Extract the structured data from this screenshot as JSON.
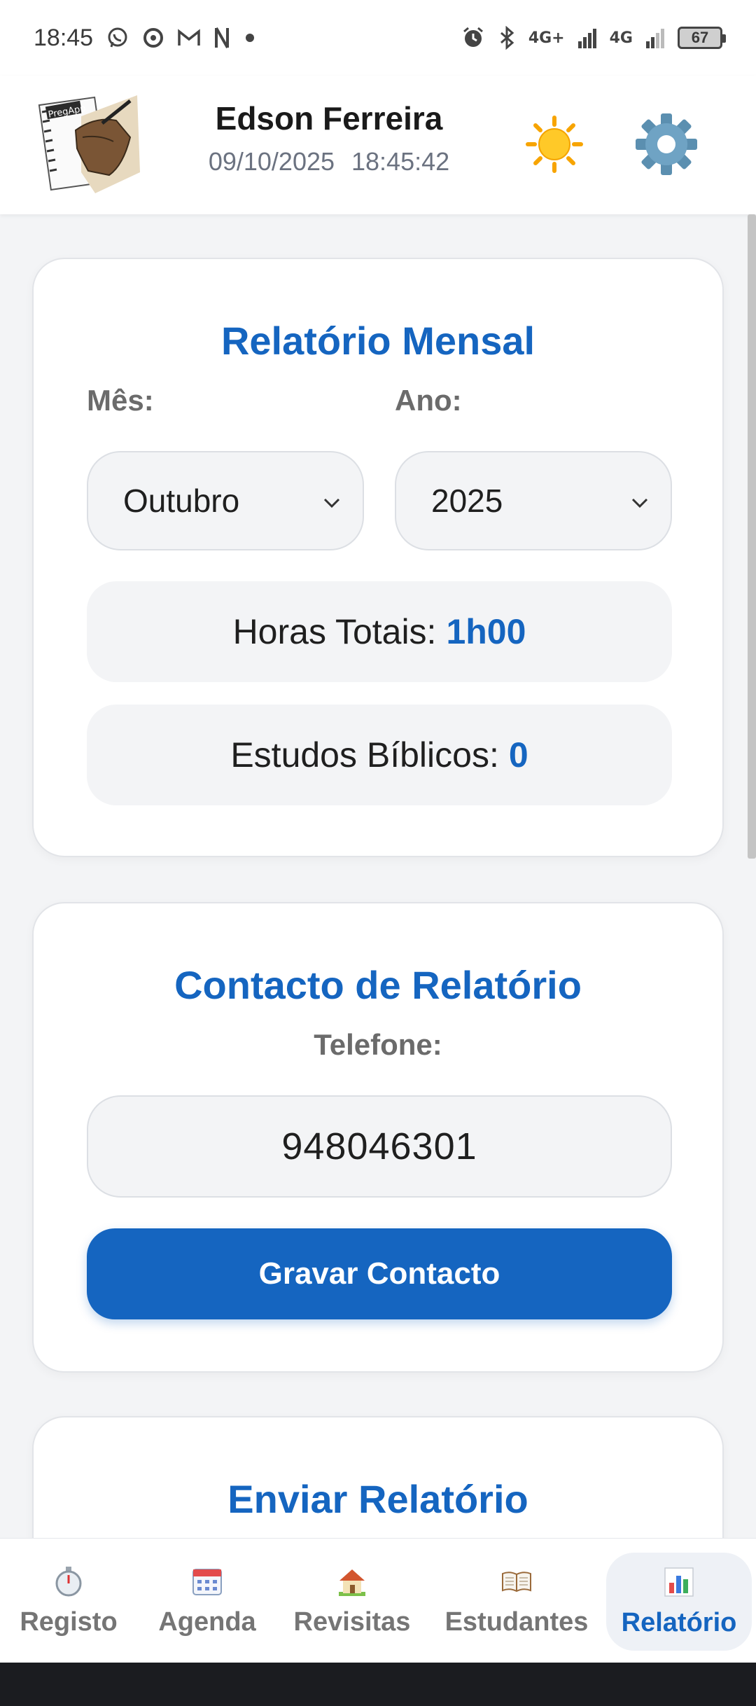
{
  "status_bar": {
    "time": "18:45",
    "left_icons": [
      "whatsapp-icon",
      "chrome-icon",
      "gmail-icon",
      "netflix-icon",
      "dot-icon"
    ],
    "network_1": "4G+",
    "network_2": "4G",
    "battery": "67"
  },
  "header": {
    "logo_text": "PregApp",
    "user_name": "Edson Ferreira",
    "date": "09/10/2025",
    "time": "18:45:42"
  },
  "monthly_report": {
    "title": "Relatório Mensal",
    "month_label": "Mês:",
    "month_value": "Outubro",
    "year_label": "Ano:",
    "year_value": "2025",
    "hours_label": "Horas Totais:",
    "hours_value": "1h00",
    "studies_label": "Estudos Bíblicos:",
    "studies_value": "0"
  },
  "report_contact": {
    "title": "Contacto de Relatório",
    "phone_label": "Telefone:",
    "phone_value": "948046301",
    "save_button": "Gravar Contacto"
  },
  "send_report": {
    "title": "Enviar Relatório"
  },
  "bottom_nav": {
    "items": [
      {
        "label": "Registo",
        "icon": "stopwatch-icon"
      },
      {
        "label": "Agenda",
        "icon": "calendar-icon"
      },
      {
        "label": "Revisitas",
        "icon": "house-icon"
      },
      {
        "label": "Estudantes",
        "icon": "book-icon"
      },
      {
        "label": "Relatório",
        "icon": "bar-chart-icon",
        "active": true
      }
    ]
  },
  "colors": {
    "accent": "#1565c0",
    "background": "#f3f4f6",
    "card": "#ffffff"
  }
}
